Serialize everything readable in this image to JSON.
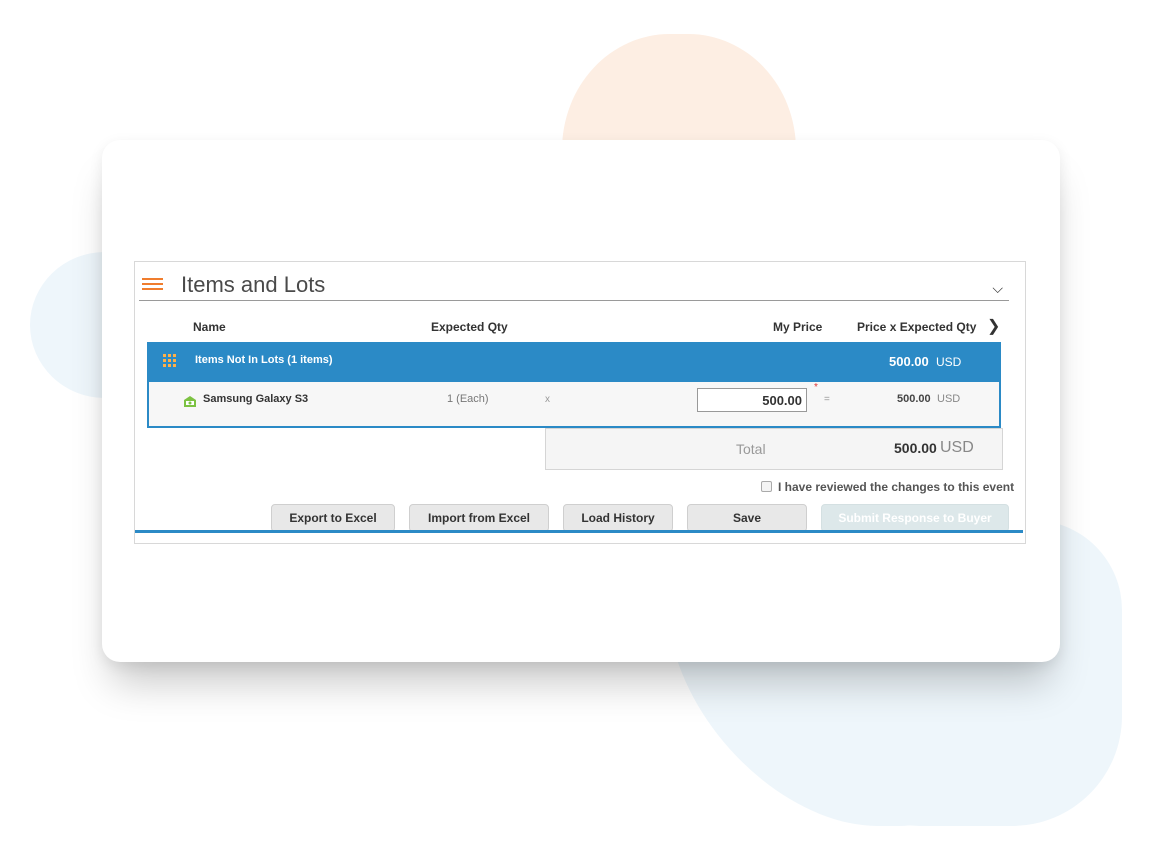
{
  "section": {
    "title": "Items and Lots",
    "icon": "list-icon",
    "collapse_icon": "chevron-down-icon"
  },
  "columns": {
    "name": "Name",
    "expected_qty": "Expected Qty",
    "my_price": "My Price",
    "price_x_qty": "Price x Expected Qty"
  },
  "group": {
    "label": "Items Not In Lots (1 items)",
    "amount": "500.00",
    "currency": "USD"
  },
  "item": {
    "name": "Samsung Galaxy S3",
    "qty": "1 (Each)",
    "times": "x",
    "price": "500.00",
    "required": "*",
    "equals": "=",
    "amount": "500.00",
    "currency": "USD"
  },
  "total": {
    "label": "Total",
    "amount": "500.00",
    "currency": "USD"
  },
  "review": {
    "label": "I have reviewed the changes to this event",
    "checked": false
  },
  "buttons": {
    "export": "Export to Excel",
    "import": "Import from Excel",
    "history": "Load History",
    "save": "Save",
    "submit": "Submit Response to Buyer"
  },
  "colors": {
    "accent_blue": "#2b8ac6",
    "accent_orange": "#f07d2e"
  }
}
